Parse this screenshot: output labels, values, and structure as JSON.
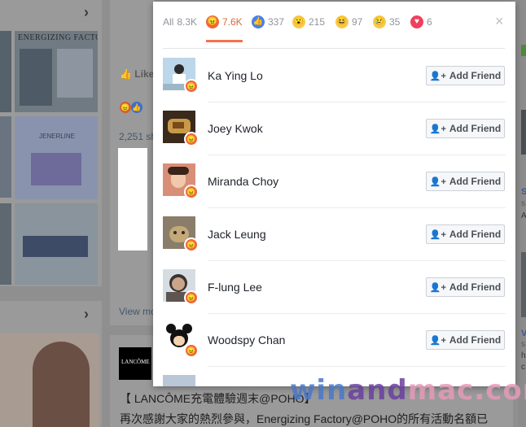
{
  "tabs": [
    {
      "label": "All",
      "count": "8.3K",
      "icon": "all"
    },
    {
      "label": "",
      "count": "7.6K",
      "icon": "angry-icon",
      "color": "#f0663d"
    },
    {
      "label": "",
      "count": "337",
      "icon": "like-icon",
      "color": "#4a80e8"
    },
    {
      "label": "",
      "count": "215",
      "icon": "wow-icon",
      "color": "#f7c94b"
    },
    {
      "label": "",
      "count": "97",
      "icon": "haha-icon",
      "color": "#f7c94b"
    },
    {
      "label": "",
      "count": "35",
      "icon": "sad-icon",
      "color": "#f7c94b"
    },
    {
      "label": "",
      "count": "6",
      "icon": "love-icon",
      "color": "#f0405c"
    }
  ],
  "close_glyph": "×",
  "people": [
    {
      "name": "Ka Ying Lo",
      "button": "Add Friend"
    },
    {
      "name": "Joey Kwok",
      "button": "Add Friend"
    },
    {
      "name": "Miranda Choy",
      "button": "Add Friend"
    },
    {
      "name": "Jack Leung",
      "button": "Add Friend"
    },
    {
      "name": "F-lung Lee",
      "button": "Add Friend"
    },
    {
      "name": "Woodspy Chan",
      "button": "Add Friend"
    }
  ],
  "background": {
    "like_label": "Like",
    "shares": "2,251 sh",
    "view_more": "View mo",
    "thumb_title": "ENERGIZING FACTORY",
    "post_logo": "LANCÔME",
    "post_line1": "【 LANCÔME充電體驗週末@POHO】",
    "post_line2": "再次感謝大家的熱烈參與，Energizing Factory@POHO的所有活動名額已",
    "thumb2_caption": "JENERLINE",
    "right_letters": [
      "S",
      "s",
      "A",
      "V",
      "s",
      "h",
      "c"
    ]
  },
  "watermark": {
    "part1": "win",
    "part2": "and",
    "part3": "mac",
    "part4": ".com"
  },
  "colors": {
    "accent": "#f7714c",
    "button_border": "#ccd0d5",
    "text": "#1d2129",
    "muted": "#90949c"
  }
}
